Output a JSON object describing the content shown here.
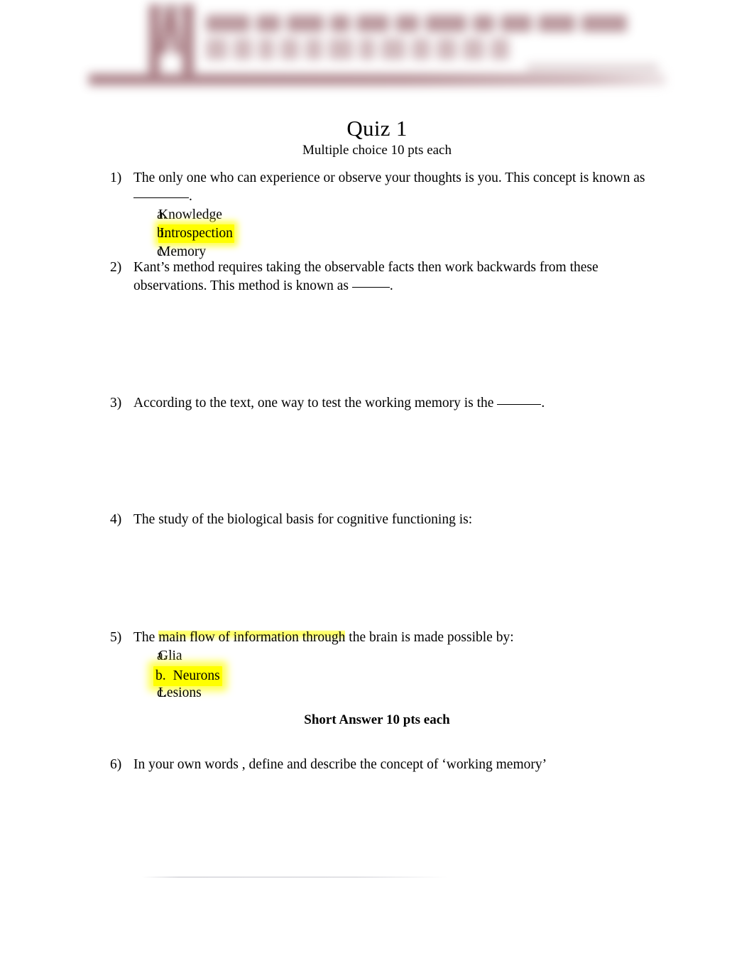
{
  "document": {
    "title": "Quiz 1",
    "subtitle": "Multiple choice 10 pts each",
    "short_answer_heading": "Short Answer 10 pts each",
    "letterhead": {
      "type": "university-letterhead-logo",
      "state": "blurred-redacted",
      "accent_color": "#9c6a72",
      "rule_color": "#a6777e"
    },
    "highlight_color": "#ffff00",
    "text_color": "#000000",
    "background_color": "#ffffff"
  },
  "questions": [
    {
      "number": "1)",
      "text_before_blank": "The only one who can experience or observe your thoughts is you. This concept is known as ",
      "blank": "________",
      "text_after_blank": ".",
      "options": [
        {
          "marker": "a.",
          "label": "Knowledge",
          "highlighted": false
        },
        {
          "marker": "b.",
          "label": "Introspection",
          "highlighted": true
        },
        {
          "marker": "c.",
          "label": "Memory",
          "highlighted": false
        }
      ]
    },
    {
      "number": "2)",
      "text_before_blank": "Kant’s method requires taking the observable facts then work backwards from these observations. This method is known as ",
      "blank": "_____",
      "text_after_blank": ".",
      "options": []
    },
    {
      "number": "3)",
      "text_before_blank": "According to the text, one way to test the working memory is the ",
      "blank": "______",
      "text_after_blank": ".",
      "options": []
    },
    {
      "number": "4)",
      "text_before_blank": "The study of the biological basis for cognitive functioning is:",
      "blank": "",
      "text_after_blank": "",
      "options": []
    },
    {
      "number": "5)",
      "text_lead": "The ",
      "text_highlighted": "main flow of information through",
      "text_tail": " the brain is made possible by:",
      "options": [
        {
          "marker": "a.",
          "label": "Glia",
          "highlighted": false
        },
        {
          "marker": "b.",
          "label": "Neurons",
          "highlighted": true
        },
        {
          "marker": "c.",
          "label": "Lesions",
          "highlighted": false
        }
      ]
    },
    {
      "number": "6)",
      "text_before_blank": "In your own words , define and describe the concept of ‘working memory’",
      "blank": "",
      "text_after_blank": "",
      "options": []
    }
  ]
}
